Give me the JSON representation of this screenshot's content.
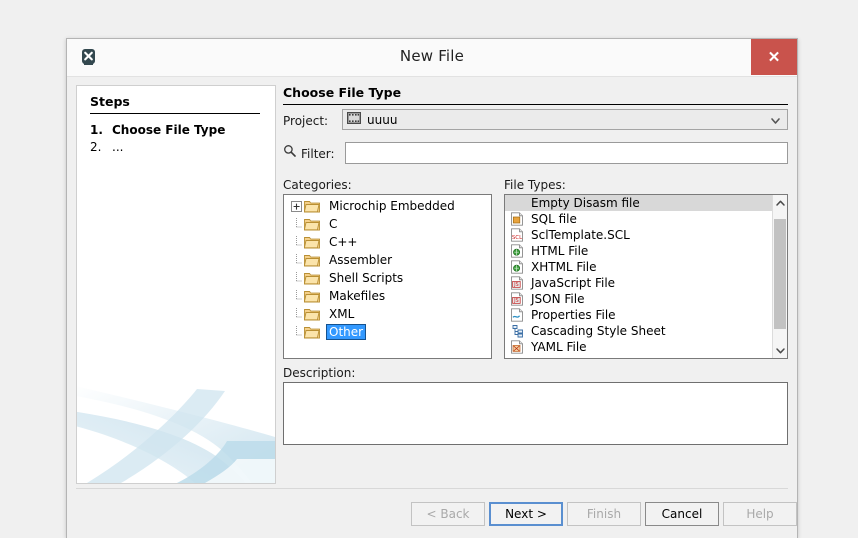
{
  "window": {
    "title": "New File",
    "icon": "app-x-icon",
    "close_label": "✕",
    "close_color": "#c9534c"
  },
  "steps": {
    "heading": "Steps",
    "items": [
      {
        "num": "1.",
        "label": "Choose File Type"
      },
      {
        "num": "2.",
        "label": "..."
      }
    ]
  },
  "main": {
    "section_title": "Choose File Type",
    "project": {
      "label": "Project:",
      "value": "uuuu",
      "icon": "project-icon",
      "arrow_icon": "chevron-down-icon"
    },
    "filter": {
      "label": "Filter:",
      "value": "",
      "placeholder": "",
      "icon": "search-icon"
    },
    "categories": {
      "label": "Categories:",
      "selected": "Other",
      "items": [
        {
          "label": "Microchip Embedded",
          "expandable": true,
          "selected": false
        },
        {
          "label": "C",
          "expandable": false,
          "selected": false
        },
        {
          "label": "C++",
          "expandable": false,
          "selected": false
        },
        {
          "label": "Assembler",
          "expandable": false,
          "selected": false
        },
        {
          "label": "Shell Scripts",
          "expandable": false,
          "selected": false
        },
        {
          "label": "Makefiles",
          "expandable": false,
          "selected": false
        },
        {
          "label": "XML",
          "expandable": false,
          "selected": false
        },
        {
          "label": "Other",
          "expandable": false,
          "selected": true
        }
      ]
    },
    "file_types": {
      "label": "File Types:",
      "selected": "Empty Disasm file",
      "items": [
        {
          "label": "Empty Disasm file",
          "icon": "blank-icon",
          "selected": true
        },
        {
          "label": "SQL file",
          "icon": "sql-file-icon",
          "selected": false
        },
        {
          "label": "SclTemplate.SCL",
          "icon": "scl-file-icon",
          "selected": false
        },
        {
          "label": "HTML File",
          "icon": "html-file-icon",
          "selected": false
        },
        {
          "label": "XHTML File",
          "icon": "xhtml-file-icon",
          "selected": false
        },
        {
          "label": "JavaScript File",
          "icon": "js-file-icon",
          "selected": false
        },
        {
          "label": "JSON File",
          "icon": "json-file-icon",
          "selected": false
        },
        {
          "label": "Properties File",
          "icon": "properties-file-icon",
          "selected": false
        },
        {
          "label": "Cascading Style Sheet",
          "icon": "css-file-icon",
          "selected": false
        },
        {
          "label": "YAML File",
          "icon": "yaml-file-icon",
          "selected": false
        }
      ],
      "scrollbar": {
        "up_icon": "chevron-up-icon",
        "down_icon": "chevron-down-icon"
      }
    },
    "description": {
      "label": "Description:",
      "value": ""
    }
  },
  "footer": {
    "buttons": [
      {
        "label": "< Back",
        "state": "disabled"
      },
      {
        "label": "Next >",
        "state": "default"
      },
      {
        "label": "Finish",
        "state": "disabled"
      },
      {
        "label": "Cancel",
        "state": "enabled"
      },
      {
        "label": "Help",
        "state": "disabled"
      }
    ]
  }
}
